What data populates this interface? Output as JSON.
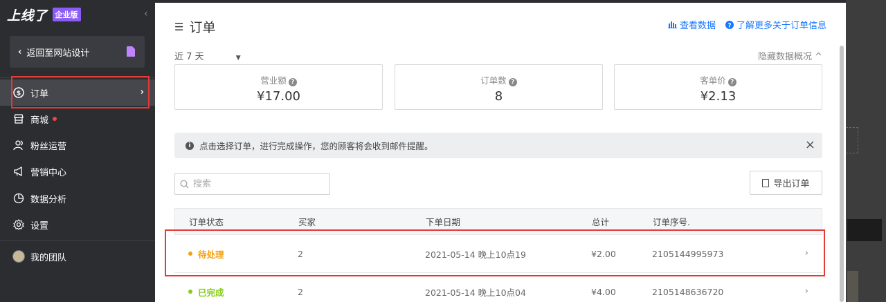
{
  "sidebar": {
    "logo": "上线了",
    "edition": "企业版",
    "back_label": "返回至网站设计",
    "items": [
      {
        "label": "订单",
        "icon": "currency-circle-icon"
      },
      {
        "label": "商城",
        "icon": "store-icon"
      },
      {
        "label": "粉丝运营",
        "icon": "users-icon"
      },
      {
        "label": "营销中心",
        "icon": "megaphone-icon"
      },
      {
        "label": "数据分析",
        "icon": "pie-chart-icon"
      },
      {
        "label": "设置",
        "icon": "gear-icon"
      }
    ],
    "team_label": "我的团队"
  },
  "main": {
    "title": "订单",
    "view_data": "查看数据",
    "learn_more": "了解更多关于订单信息",
    "period": "近 7 天",
    "hide_overview": "隐藏数据概况 ^",
    "stats": [
      {
        "label": "营业额",
        "value": "¥17.00"
      },
      {
        "label": "订单数",
        "value": "8"
      },
      {
        "label": "客单价",
        "value": "¥2.13"
      }
    ],
    "notice": "点击选择订单，进行完成操作，您的顾客将会收到邮件提醒。",
    "search_placeholder": "搜索",
    "export_label": "导出订单",
    "columns": [
      "订单状态",
      "买家",
      "下单日期",
      "总计",
      "订单序号."
    ],
    "rows": [
      {
        "status": "待处理",
        "buyer": "2",
        "date": "2021-05-14 晚上10点19",
        "total": "¥2.00",
        "order_no": "2105144995973"
      },
      {
        "status": "已完成",
        "buyer": "2",
        "date": "2021-05-14 晚上10点04",
        "total": "¥4.00",
        "order_no": "2105148636720"
      }
    ]
  },
  "colors": {
    "pending": "#f59e0b",
    "done": "#84cc16",
    "link": "#1677ff",
    "highlight": "#e53935"
  }
}
